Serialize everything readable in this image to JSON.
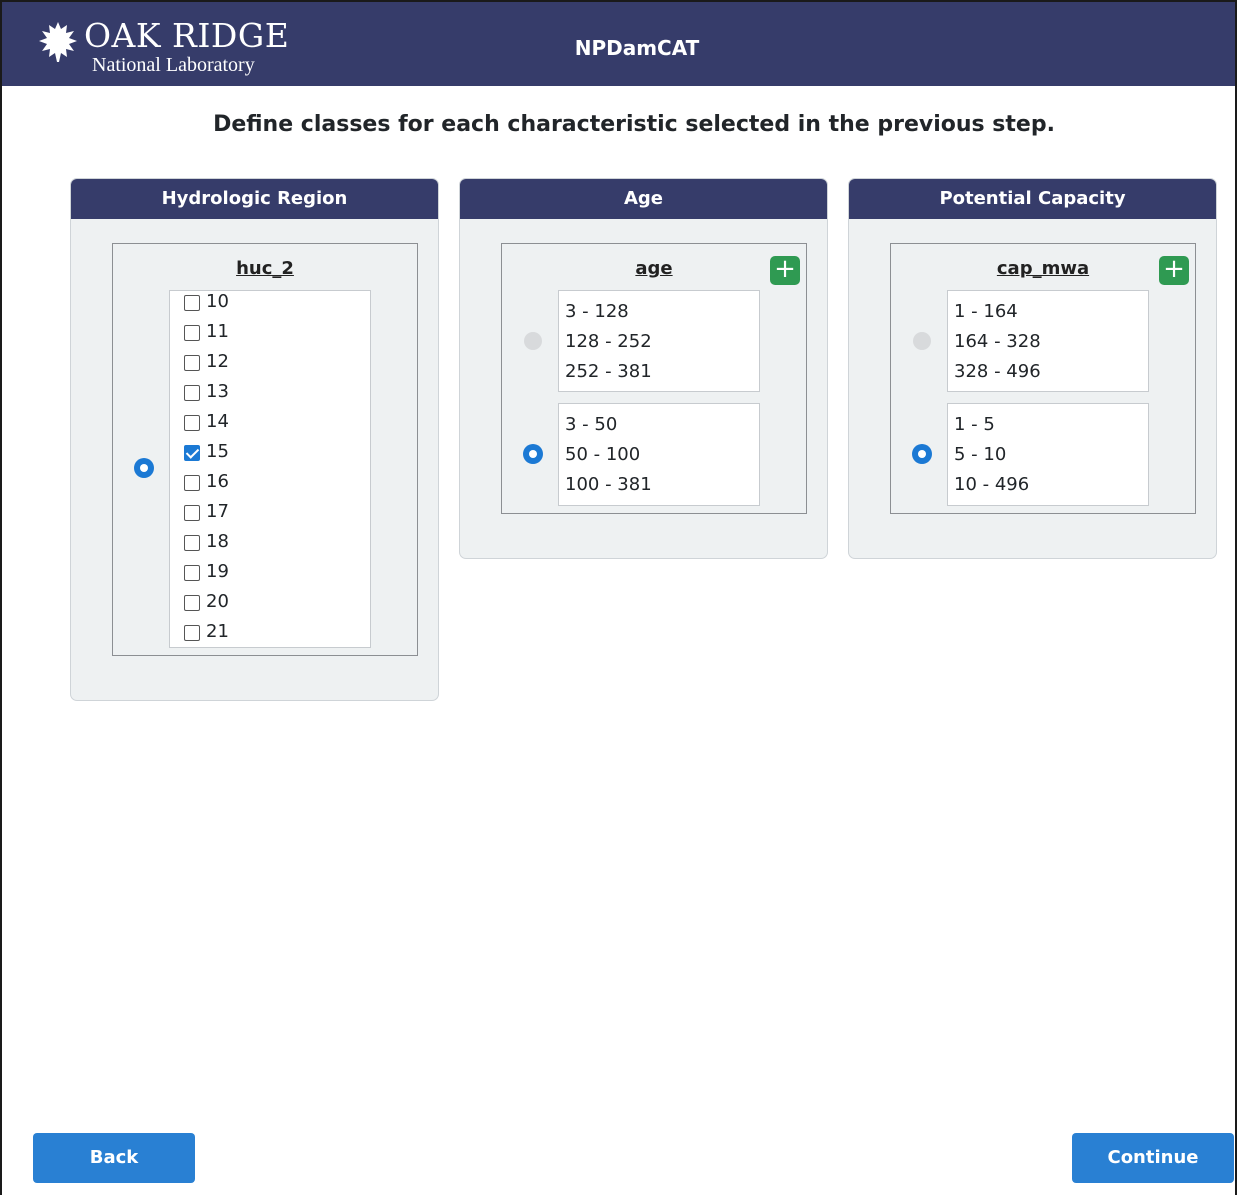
{
  "header": {
    "logo_line1": "OAK RIDGE",
    "logo_line2": "National Laboratory",
    "app_title": "NPDamCAT"
  },
  "heading": "Define classes for each characteristic selected in the previous step.",
  "panels": [
    {
      "title": "Hydrologic Region",
      "field": "huc_2",
      "items": [
        {
          "label": "10",
          "checked": false
        },
        {
          "label": "11",
          "checked": false
        },
        {
          "label": "12",
          "checked": false
        },
        {
          "label": "13",
          "checked": false
        },
        {
          "label": "14",
          "checked": false
        },
        {
          "label": "15",
          "checked": true
        },
        {
          "label": "16",
          "checked": false
        },
        {
          "label": "17",
          "checked": false
        },
        {
          "label": "18",
          "checked": false
        },
        {
          "label": "19",
          "checked": false
        },
        {
          "label": "20",
          "checked": false
        },
        {
          "label": "21",
          "checked": false
        }
      ],
      "selected": true
    },
    {
      "title": "Age",
      "field": "age",
      "add_label": "+",
      "options": [
        {
          "ranges": [
            "3 - 128",
            "128 - 252",
            "252 - 381"
          ],
          "selected": false
        },
        {
          "ranges": [
            "3 - 50",
            "50 - 100",
            "100 - 381"
          ],
          "selected": true
        }
      ]
    },
    {
      "title": "Potential Capacity",
      "field": "cap_mwa",
      "add_label": "+",
      "options": [
        {
          "ranges": [
            "1 - 164",
            "164 - 328",
            "328 - 496"
          ],
          "selected": false
        },
        {
          "ranges": [
            "1 - 5",
            "5 - 10",
            "10 - 496"
          ],
          "selected": true
        }
      ]
    }
  ],
  "footer": {
    "back_label": "Back",
    "continue_label": "Continue"
  },
  "colors": {
    "header_bg": "#363c6a",
    "panel_bg": "#eef1f2",
    "button_bg": "#2980d3",
    "add_button_bg": "#2f9a52",
    "radio_selected": "#1b79d4"
  }
}
